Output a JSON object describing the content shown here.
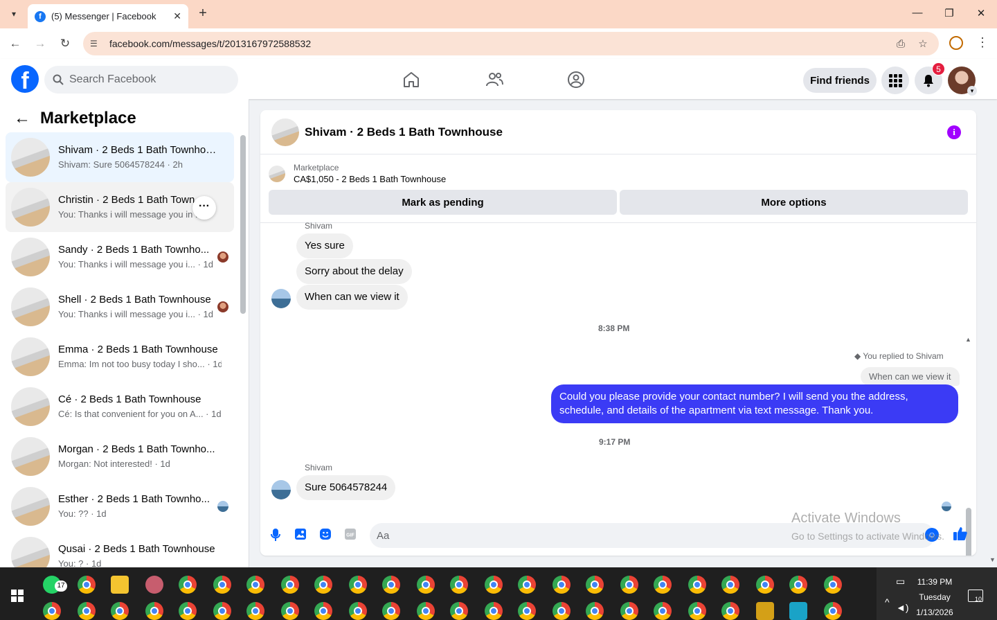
{
  "browser": {
    "tab_title": "(5) Messenger | Facebook",
    "url": "facebook.com/messages/t/2013167972588532"
  },
  "fb": {
    "search_placeholder": "Search Facebook",
    "find_friends": "Find friends",
    "notifications_count": "5"
  },
  "sidebar": {
    "title": "Marketplace",
    "conversations": [
      {
        "name": "Shivam · 2 Beds 1 Bath Townhouse",
        "preview": "Shivam: Sure 5064578244 · 2h"
      },
      {
        "name": "Christin · 2 Beds 1 Bath Town...",
        "preview": "You: Thanks i will message you in ...h"
      },
      {
        "name": "Sandy · 2 Beds 1 Bath Townho...",
        "preview": "You: Thanks i will message you i... · 1d"
      },
      {
        "name": "Shell · 2 Beds 1 Bath Townhouse",
        "preview": "You: Thanks i will message you i... · 1d"
      },
      {
        "name": "Emma · 2 Beds 1 Bath Townhouse",
        "preview": "Emma: Im not too busy today I sho... · 1d"
      },
      {
        "name": "Cé · 2 Beds 1 Bath Townhouse",
        "preview": "Cé: Is that convenient for you on A... · 1d"
      },
      {
        "name": "Morgan · 2 Beds 1 Bath Townho...",
        "preview": "Morgan: Not interested! · 1d"
      },
      {
        "name": "Esther · 2 Beds 1 Bath Townho...",
        "preview": "You: ?? · 1d"
      },
      {
        "name": "Qusai · 2 Beds 1 Bath Townhouse",
        "preview": "You: ? · 1d"
      }
    ]
  },
  "chat": {
    "title": "Shivam · 2 Beds 1 Bath Townhouse",
    "marketplace_label": "Marketplace",
    "listing": "CA$1,050 - 2 Beds 1 Bath Townhouse",
    "mark_pending": "Mark as pending",
    "more_options": "More options",
    "sender_name": "Shivam",
    "msg1": "Yes sure",
    "msg2": "Sorry about the delay",
    "msg3": "When can we view it",
    "time1": "8:38 PM",
    "replied_to": "You replied to Shivam",
    "quoted": "When can we view it",
    "my_msg": "Could you please provide your contact number? I will send you the address, schedule, and details of the apartment via text message. Thank you.",
    "time2": "9:17 PM",
    "sender_name2": "Shivam",
    "msg4": "Sure 5064578244",
    "composer_placeholder": "Aa"
  },
  "watermark": {
    "line1": "Activate Windows",
    "line2": "Go to Settings to activate Windows."
  },
  "taskbar": {
    "time": "11:39 PM",
    "day": "Tuesday",
    "date": "1/13/2026",
    "whatsapp_badge": "17",
    "notif_count": "10"
  }
}
